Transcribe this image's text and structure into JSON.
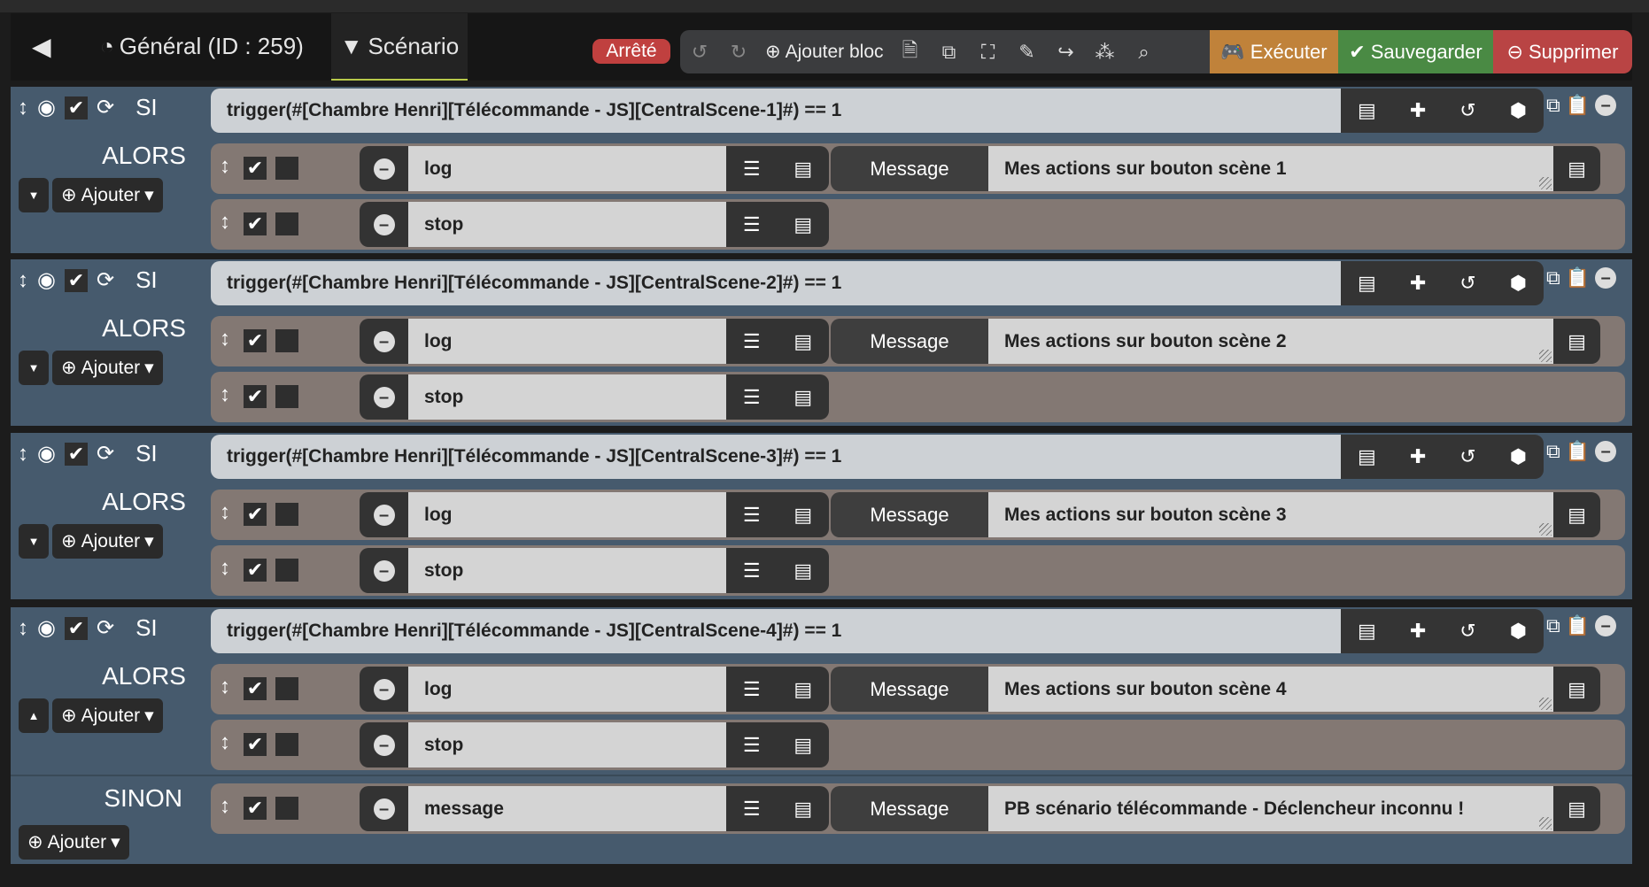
{
  "header": {
    "general_tab": "Général (ID : 259)",
    "scenario_tab": "Scénario",
    "status_badge": "Arrêté",
    "add_block": "Ajouter bloc",
    "execute": "Exécuter",
    "save": "Sauvegarder",
    "delete": "Supprimer"
  },
  "colors": {
    "execute": "#c0823a",
    "save": "#4a8a44",
    "delete": "#b94444",
    "block": "#465a6d",
    "action_row": "#837873"
  },
  "labels": {
    "si": "SI",
    "alors": "ALORS",
    "sinon": "SINON",
    "add": "Ajouter",
    "message_label": "Message"
  },
  "blocks": [
    {
      "condition": "trigger(#[Chambre Henri][Télécommande - JS][CentralScene-1]#) == 1",
      "actions": [
        {
          "cmd": "log",
          "message": "Mes actions sur bouton scène 1"
        },
        {
          "cmd": "stop"
        }
      ]
    },
    {
      "condition": "trigger(#[Chambre Henri][Télécommande - JS][CentralScene-2]#) == 1",
      "actions": [
        {
          "cmd": "log",
          "message": "Mes actions sur bouton scène 2"
        },
        {
          "cmd": "stop"
        }
      ]
    },
    {
      "condition": "trigger(#[Chambre Henri][Télécommande - JS][CentralScene-3]#) == 1",
      "actions": [
        {
          "cmd": "log",
          "message": "Mes actions sur bouton scène 3"
        },
        {
          "cmd": "stop"
        }
      ]
    },
    {
      "condition": "trigger(#[Chambre Henri][Télécommande - JS][CentralScene-4]#) == 1",
      "actions": [
        {
          "cmd": "log",
          "message": "Mes actions sur bouton scène 4"
        },
        {
          "cmd": "stop"
        }
      ],
      "else_actions": [
        {
          "cmd": "message",
          "message": "PB scénario télécommande - Déclencheur inconnu !"
        }
      ]
    }
  ]
}
